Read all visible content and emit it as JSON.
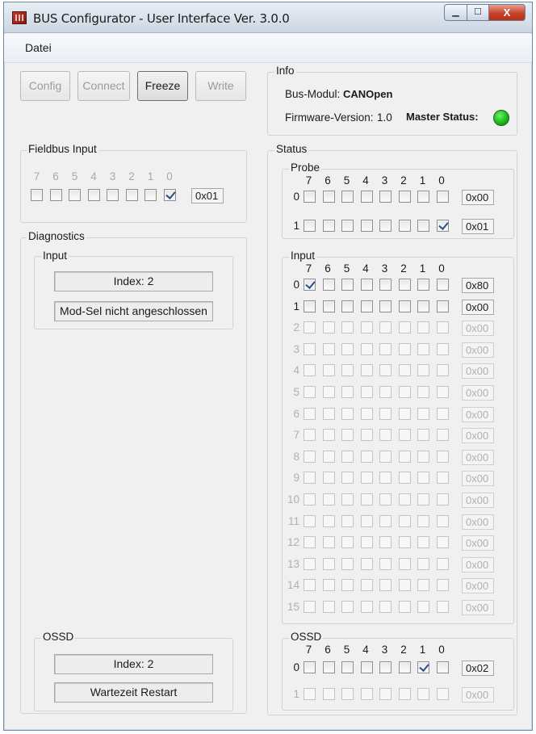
{
  "window": {
    "title": "BUS Configurator - User Interface   Ver. 3.0.0",
    "minimize_glyph": "▁",
    "maximize_glyph": "☐",
    "close_glyph": "X"
  },
  "menu": {
    "items": [
      "Datei"
    ]
  },
  "toolbar": {
    "config_label": "Config",
    "connect_label": "Connect",
    "freeze_label": "Freeze",
    "write_label": "Write"
  },
  "info": {
    "title": "Info",
    "bus_modul_label": "Bus-Modul:",
    "bus_modul_value": "CANOpen",
    "firmware_label": "Firmware-Version:",
    "firmware_value": "1.0",
    "master_status_label": "Master Status:",
    "master_status_color": "#14b414"
  },
  "fieldbus_input": {
    "title": "Fieldbus Input",
    "bits": [
      "7",
      "6",
      "5",
      "4",
      "3",
      "2",
      "1",
      "0"
    ],
    "checked": [
      false,
      false,
      false,
      false,
      false,
      false,
      false,
      true
    ],
    "hex": "0x01"
  },
  "diagnostics": {
    "title": "Diagnostics",
    "input": {
      "title": "Input",
      "index": "Index: 2",
      "message": "Mod-Sel nicht angeschlossen"
    },
    "ossd": {
      "title": "OSSD",
      "index": "Index: 2",
      "message": "Wartezeit Restart"
    }
  },
  "status": {
    "title": "Status",
    "bits": [
      "7",
      "6",
      "5",
      "4",
      "3",
      "2",
      "1",
      "0"
    ],
    "probe": {
      "title": "Probe",
      "rows": [
        {
          "label": "0",
          "hex": "0x00",
          "checked": [
            false,
            false,
            false,
            false,
            false,
            false,
            false,
            false
          ],
          "enabled": true
        },
        {
          "label": "1",
          "hex": "0x01",
          "checked": [
            false,
            false,
            false,
            false,
            false,
            false,
            false,
            true
          ],
          "enabled": true
        }
      ]
    },
    "input": {
      "title": "Input",
      "rows": [
        {
          "label": "0",
          "hex": "0x80",
          "checked": [
            true,
            false,
            false,
            false,
            false,
            false,
            false,
            false
          ],
          "enabled": true
        },
        {
          "label": "1",
          "hex": "0x00",
          "checked": [
            false,
            false,
            false,
            false,
            false,
            false,
            false,
            false
          ],
          "enabled": true
        },
        {
          "label": "2",
          "hex": "0x00",
          "checked": [
            false,
            false,
            false,
            false,
            false,
            false,
            false,
            false
          ],
          "enabled": false
        },
        {
          "label": "3",
          "hex": "0x00",
          "checked": [
            false,
            false,
            false,
            false,
            false,
            false,
            false,
            false
          ],
          "enabled": false
        },
        {
          "label": "4",
          "hex": "0x00",
          "checked": [
            false,
            false,
            false,
            false,
            false,
            false,
            false,
            false
          ],
          "enabled": false
        },
        {
          "label": "5",
          "hex": "0x00",
          "checked": [
            false,
            false,
            false,
            false,
            false,
            false,
            false,
            false
          ],
          "enabled": false
        },
        {
          "label": "6",
          "hex": "0x00",
          "checked": [
            false,
            false,
            false,
            false,
            false,
            false,
            false,
            false
          ],
          "enabled": false
        },
        {
          "label": "7",
          "hex": "0x00",
          "checked": [
            false,
            false,
            false,
            false,
            false,
            false,
            false,
            false
          ],
          "enabled": false
        },
        {
          "label": "8",
          "hex": "0x00",
          "checked": [
            false,
            false,
            false,
            false,
            false,
            false,
            false,
            false
          ],
          "enabled": false
        },
        {
          "label": "9",
          "hex": "0x00",
          "checked": [
            false,
            false,
            false,
            false,
            false,
            false,
            false,
            false
          ],
          "enabled": false
        },
        {
          "label": "10",
          "hex": "0x00",
          "checked": [
            false,
            false,
            false,
            false,
            false,
            false,
            false,
            false
          ],
          "enabled": false
        },
        {
          "label": "11",
          "hex": "0x00",
          "checked": [
            false,
            false,
            false,
            false,
            false,
            false,
            false,
            false
          ],
          "enabled": false
        },
        {
          "label": "12",
          "hex": "0x00",
          "checked": [
            false,
            false,
            false,
            false,
            false,
            false,
            false,
            false
          ],
          "enabled": false
        },
        {
          "label": "13",
          "hex": "0x00",
          "checked": [
            false,
            false,
            false,
            false,
            false,
            false,
            false,
            false
          ],
          "enabled": false
        },
        {
          "label": "14",
          "hex": "0x00",
          "checked": [
            false,
            false,
            false,
            false,
            false,
            false,
            false,
            false
          ],
          "enabled": false
        },
        {
          "label": "15",
          "hex": "0x00",
          "checked": [
            false,
            false,
            false,
            false,
            false,
            false,
            false,
            false
          ],
          "enabled": false
        }
      ]
    },
    "ossd": {
      "title": "OSSD",
      "rows": [
        {
          "label": "0",
          "hex": "0x02",
          "checked": [
            false,
            false,
            false,
            false,
            false,
            false,
            true,
            false
          ],
          "enabled": true
        },
        {
          "label": "1",
          "hex": "0x00",
          "checked": [
            false,
            false,
            false,
            false,
            false,
            false,
            false,
            false
          ],
          "enabled": false
        }
      ]
    }
  }
}
